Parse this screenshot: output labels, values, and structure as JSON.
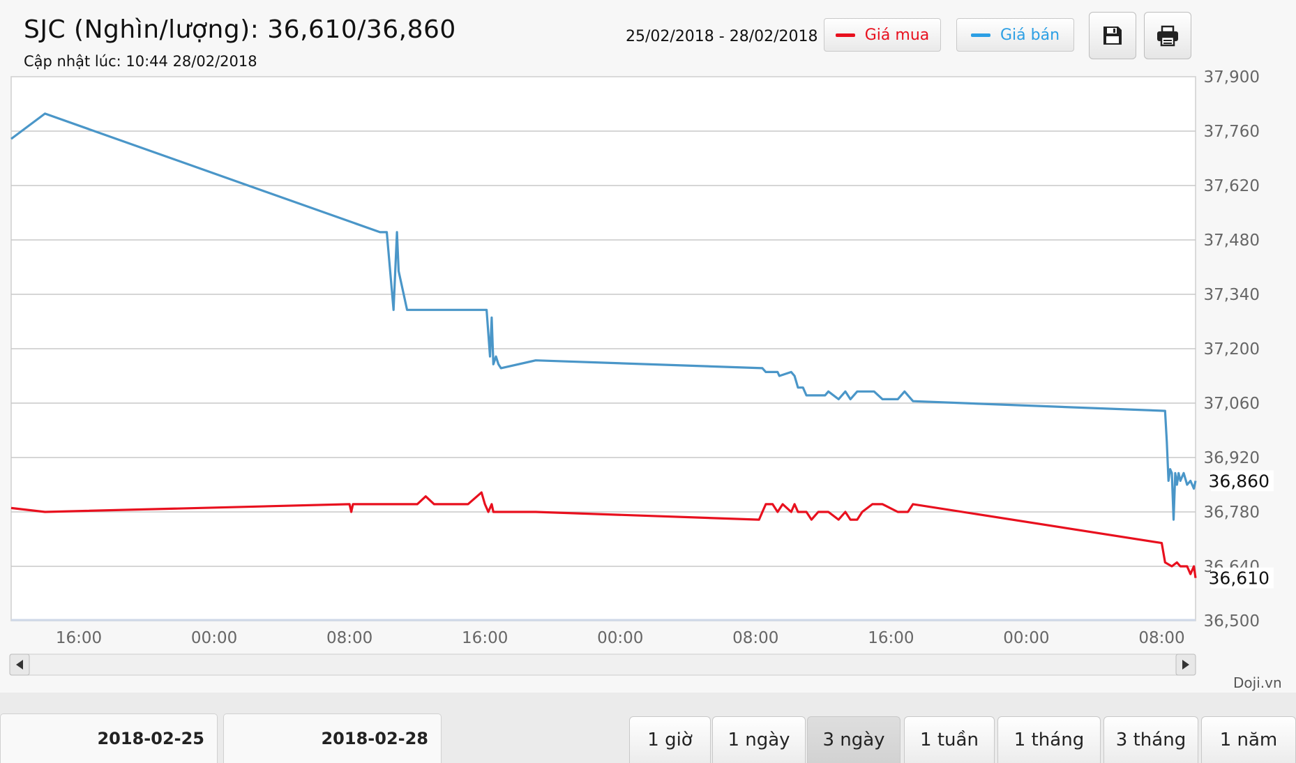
{
  "header": {
    "title": "SJC (Nghìn/lượng): 36,610/36,860",
    "updated": "Cập nhật lúc: 10:44 28/02/2018",
    "date_range": "25/02/2018 - 28/02/2018"
  },
  "legend": {
    "buy_label": "Giá mua",
    "sell_label": "Giá bán",
    "buy_color": "#e8101e",
    "sell_color": "#4a96c8"
  },
  "toolbar": {
    "save_icon": "floppy-disk-icon",
    "print_icon": "printer-icon"
  },
  "credit": "Doji.vn",
  "date_tabs": [
    "2018-02-25",
    "2018-02-28"
  ],
  "period_tabs": [
    "1 giờ",
    "1 ngày",
    "3 ngày",
    "1 tuần",
    "1 tháng",
    "3 tháng",
    "1 năm"
  ],
  "active_period": "3 ngày",
  "scrollbar": {
    "left_icon": "arrow-left-icon",
    "right_icon": "arrow-right-icon"
  },
  "chart_data": {
    "type": "line",
    "title": "",
    "xlabel": "",
    "ylabel": "",
    "x_unit": "hours since 2018-02-27 00:00",
    "xlim": [
      -36.0,
      34.0
    ],
    "x_ticks": [
      {
        "x": -32,
        "label": "16:00"
      },
      {
        "x": -24,
        "label": "00:00"
      },
      {
        "x": -16,
        "label": "08:00"
      },
      {
        "x": -8,
        "label": "16:00"
      },
      {
        "x": 0,
        "label": "00:00"
      },
      {
        "x": 8,
        "label": "08:00"
      },
      {
        "x": 16,
        "label": "16:00"
      },
      {
        "x": 24,
        "label": "00:00"
      },
      {
        "x": 32,
        "label": "08:00"
      }
    ],
    "ylim": [
      36500,
      37900
    ],
    "y_ticks": [
      36500,
      36640,
      36780,
      36920,
      37060,
      37200,
      37340,
      37480,
      37620,
      37760,
      37900
    ],
    "y_tick_labels": [
      "36,500",
      "36,640",
      "36,780",
      "36,920",
      "37,060",
      "37,200",
      "37,340",
      "37,480",
      "37,620",
      "37,760",
      "37,900"
    ],
    "grid": true,
    "legend": "top-right",
    "last_values": [
      {
        "series": "Giá bán",
        "value": 36860,
        "label": "36,860"
      },
      {
        "series": "Giá mua",
        "value": 36610,
        "label": "36,610"
      }
    ],
    "series": [
      {
        "name": "Giá bán",
        "color": "#4a96c8",
        "x": [
          -36.0,
          -34.0,
          -14.2,
          -13.8,
          -13.4,
          -13.2,
          -13.1,
          -12.6,
          -7.9,
          -7.7,
          -7.6,
          -7.5,
          -7.35,
          -7.2,
          -7.05,
          -5.0,
          8.4,
          8.6,
          9.3,
          9.4,
          10.1,
          10.3,
          10.5,
          10.8,
          11.0,
          11.1,
          11.6,
          12.1,
          12.3,
          12.9,
          13.3,
          13.6,
          14.0,
          14.2,
          15.0,
          15.5,
          16.4,
          16.8,
          17.2,
          17.3,
          32.2,
          32.3,
          32.4,
          32.5,
          32.6,
          32.7,
          32.8,
          32.9,
          33.0,
          33.1,
          33.3,
          33.5,
          33.7,
          33.9,
          34.0
        ],
        "values": [
          37740,
          37805,
          37500,
          37500,
          37300,
          37500,
          37400,
          37300,
          37300,
          37180,
          37280,
          37160,
          37180,
          37160,
          37150,
          37170,
          37150,
          37140,
          37140,
          37130,
          37140,
          37130,
          37100,
          37100,
          37080,
          37080,
          37080,
          37080,
          37090,
          37070,
          37090,
          37070,
          37090,
          37090,
          37090,
          37070,
          37070,
          37090,
          37070,
          37065,
          37040,
          36960,
          36860,
          36890,
          36880,
          36760,
          36880,
          36850,
          36880,
          36860,
          36880,
          36850,
          36860,
          36840,
          36860
        ]
      },
      {
        "name": "Giá mua",
        "color": "#e8101e",
        "x": [
          -36.0,
          -34.0,
          -16.0,
          -15.9,
          -15.8,
          -14.0,
          -13.8,
          -12.0,
          -11.5,
          -11.0,
          -9.0,
          -8.2,
          -8.0,
          -7.8,
          -7.6,
          -7.5,
          -5.0,
          8.2,
          8.4,
          8.6,
          9.0,
          9.3,
          9.6,
          10.1,
          10.3,
          10.5,
          11.0,
          11.3,
          11.7,
          12.3,
          12.9,
          13.3,
          13.6,
          14.0,
          14.3,
          14.9,
          15.5,
          16.4,
          17.0,
          17.3,
          32.0,
          32.2,
          32.6,
          32.9,
          33.1,
          33.5,
          33.7,
          33.9,
          34.0
        ],
        "values": [
          36790,
          36780,
          36800,
          36780,
          36800,
          36800,
          36800,
          36800,
          36820,
          36800,
          36800,
          36830,
          36800,
          36780,
          36800,
          36780,
          36780,
          36760,
          36780,
          36800,
          36800,
          36780,
          36800,
          36780,
          36800,
          36780,
          36780,
          36760,
          36780,
          36780,
          36760,
          36780,
          36760,
          36760,
          36780,
          36800,
          36800,
          36780,
          36780,
          36800,
          36700,
          36650,
          36640,
          36650,
          36640,
          36640,
          36620,
          36640,
          36610
        ]
      }
    ]
  }
}
